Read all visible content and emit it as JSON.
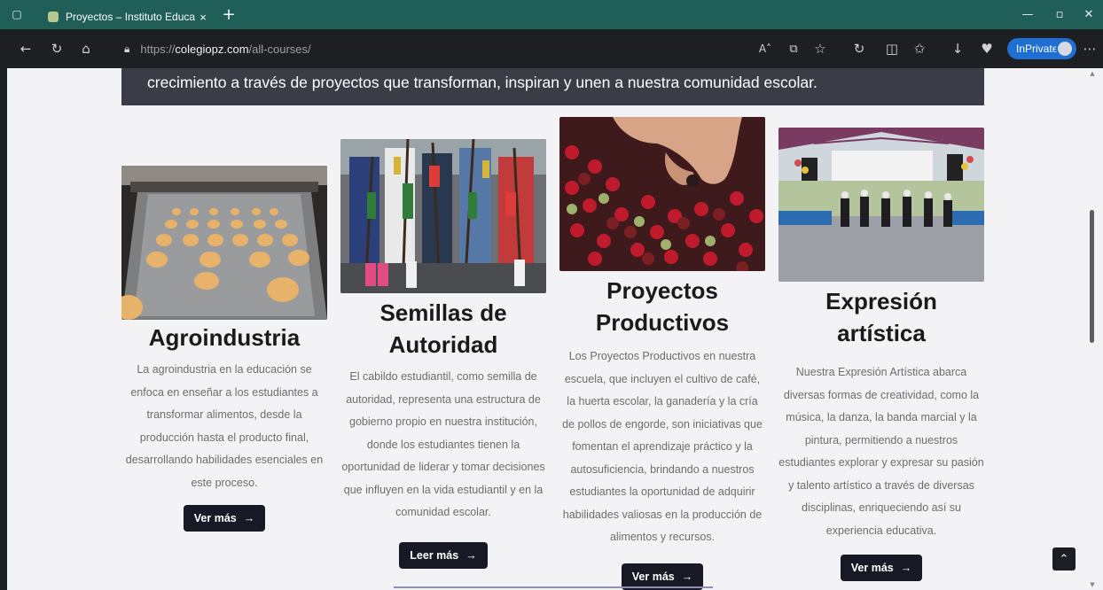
{
  "browser": {
    "tab_title": "Proyectos – Instituto Educativo I",
    "tab_close": "×",
    "new_tab": "+",
    "url_prefix": "https://",
    "url_host": "colegiopz.com",
    "url_path": "/all-courses/",
    "inprivate_label": "InPrivate"
  },
  "banner": {
    "text": "crecimiento a través de proyectos que transforman, inspiran y unen a nuestra comunidad escolar."
  },
  "cards": [
    {
      "title": "Agroindustria",
      "text": "La agroindustria en la educación se enfoca en enseñar a los estudiantes a transformar alimentos, desde la producción hasta el producto final, desarrollando habilidades esenciales en este proceso.",
      "button": "Ver más"
    },
    {
      "title": "Semillas de Autoridad",
      "text": "El cabildo estudiantil, como semilla de autoridad, representa una estructura de gobierno propio en nuestra institución, donde los estudiantes tienen la oportunidad de liderar y tomar decisiones que influyen en la vida estudiantil y en la comunidad escolar.",
      "button": "Leer más"
    },
    {
      "title": "Proyectos Productivos",
      "text": "Los Proyectos Productivos en nuestra escuela, que incluyen el cultivo de café, la huerta escolar, la ganadería y la cría de pollos de engorde, son iniciativas que fomentan el aprendizaje práctico y la autosuficiencia, brindando a nuestros estudiantes la oportunidad de adquirir habilidades valiosas en la producción de alimentos y recursos.",
      "button": "Ver más"
    },
    {
      "title": "Expresión artística",
      "text": "Nuestra Expresión Artística abarca diversas formas de creatividad, como la música, la danza, la banda marcial y la pintura, permitiendo a nuestros estudiantes explorar y expresar su pasión y talento artístico a través de diversas disciplinas, enriqueciendo así su experiencia educativa.",
      "button": "Ver más"
    }
  ],
  "icons": {
    "arrow": "→",
    "up": "⌃"
  }
}
